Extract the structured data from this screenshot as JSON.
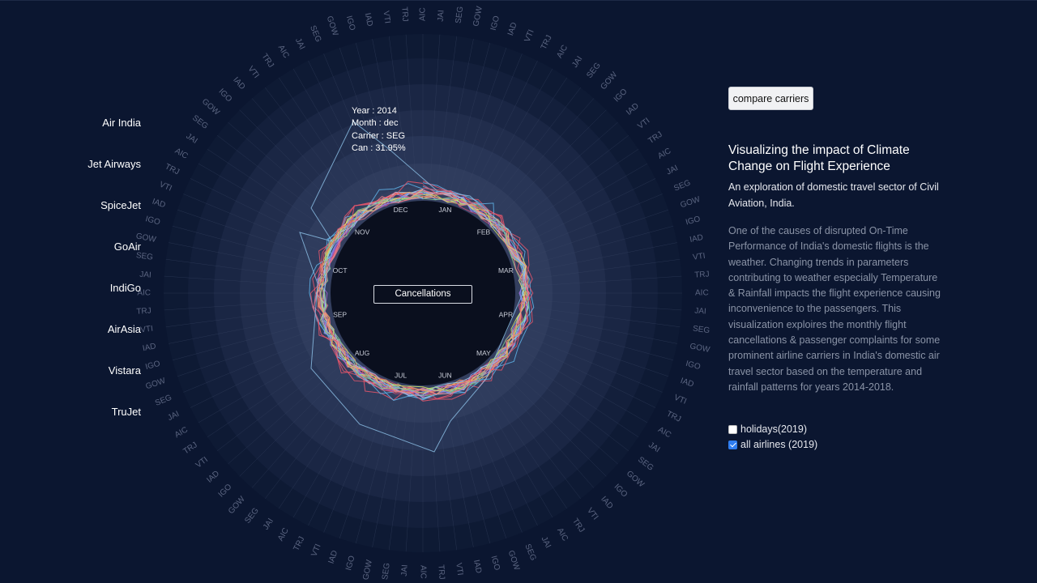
{
  "carriers": [
    "Air India",
    "Jet Airways",
    "SpiceJet",
    "GoAir",
    "IndiGo",
    "AirAsia",
    "Vistara",
    "TruJet"
  ],
  "chart_data": {
    "type": "radial-line",
    "months": [
      "JAN",
      "FEB",
      "MAR",
      "APR",
      "MAY",
      "JUN",
      "JUL",
      "AUG",
      "SEP",
      "OCT",
      "NOV",
      "DEC"
    ],
    "carrier_codes": [
      "AIC",
      "JAI",
      "SEG",
      "GOW",
      "IGO",
      "IAD",
      "VTI",
      "TRJ"
    ],
    "center_label": "Cancellations",
    "colors": [
      "#e8566b",
      "#f07c8c",
      "#c94d7a",
      "#a36ad6",
      "#7f93f0",
      "#5fb3e8",
      "#9ed0f0",
      "#d6e86a",
      "#f4a35a",
      "#86c98a"
    ]
  },
  "tooltip": {
    "line1": "Year : 2014",
    "line2": "Month : dec",
    "line3": "Carrier : SEG",
    "line4": "Can : 31.95%"
  },
  "controls": {
    "compare_label": "compare carriers",
    "holidays_label": "holidays(2019)",
    "holidays_checked": false,
    "all_airlines_label": "all airlines (2019)",
    "all_airlines_checked": true
  },
  "panel": {
    "title": "Visualizing the impact of Climate Change on Flight Experience",
    "subtitle": "An exploration of domestic travel sector of Civil Aviation, India.",
    "description": "One of the causes of disrupted On-Time Performance of India's domestic flights is the weather. Changing trends in parameters contributing to weather especially Temperature & Rainfall impacts the flight experience causing inconvenience to the passengers. This visualization exploires the monthly flight cancellations & passenger complaints for some prominent airline carriers in India's domestic air travel sector based on the temperature and rainfall patterns for years 2014-2018."
  }
}
